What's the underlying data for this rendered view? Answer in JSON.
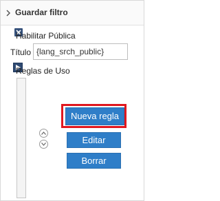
{
  "panel": {
    "title": "Guardar filtro"
  },
  "public_toggle": {
    "label": "Habilitar Pública",
    "checked": true
  },
  "title_field": {
    "label": "Título",
    "value": "{lang_srch_public}"
  },
  "rules": {
    "label": "Reglas de Uso"
  },
  "actions": {
    "new_rule": "Nueva regla",
    "edit": "Editar",
    "delete": "Borrar"
  },
  "colors": {
    "button": "#2f7ec8",
    "highlight": "#e0171e",
    "checkbox": "#34507a"
  },
  "icons": {
    "collapse": "chevron-right-icon",
    "checkbox": "checked-x-icon",
    "expand": "play-arrow-icon",
    "move_up": "chevron-up-circle-icon",
    "move_down": "chevron-down-circle-icon"
  }
}
